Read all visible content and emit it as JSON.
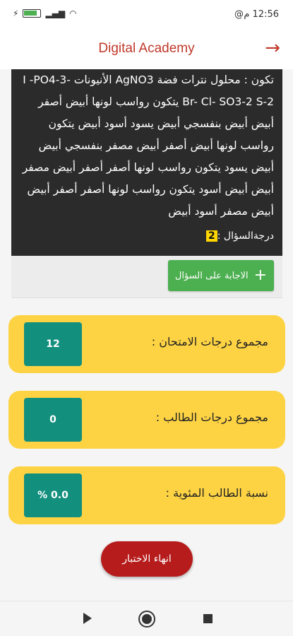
{
  "status_bar": {
    "time": "12:56",
    "am_pm": "م",
    "at_symbol": "@"
  },
  "app_bar": {
    "title": "Digital Academy",
    "back_icon": "arrow-right-icon"
  },
  "question": {
    "text": "تكون : محلول نترات فضة AgNO3 الأنيونات -I -PO4-3 Br- Cl- SO3-2 S-2 يتكون رواسب لونها أبيض أصفر أبيض أبيض بنفسجي أبيض يسود أسود أبيض يتكون رواسب لونها أبيض أصفر أبيض مصفر بنفسجي أبيض أبيض يسود يتكون رواسب لونها أصفر أصفر أبيض مصفر أبيض أبيض أسود يتكون رواسب لونها أصفر أصفر أبيض أبيض مصفر أسود أبيض",
    "degree_label": "درجةالسؤال :",
    "degree_value": "2"
  },
  "answer_button": {
    "label": "الاجابة على السؤال",
    "icon": "plus-icon"
  },
  "scores": {
    "exam_total_label": "مجموع درجات الامتحان :",
    "exam_total_value": "12",
    "student_total_label": "مجموع درجات الطالب :",
    "student_total_value": "0",
    "percentage_label": "نسبة الطالب المئوية :",
    "percentage_value": "% 0.0"
  },
  "end_button": {
    "label": "انهاء الاختبار"
  },
  "colors": {
    "accent": "#c0392b",
    "card": "#fdd344",
    "teal": "#138f7e",
    "green": "#4caf50",
    "end": "#b71c1c"
  }
}
